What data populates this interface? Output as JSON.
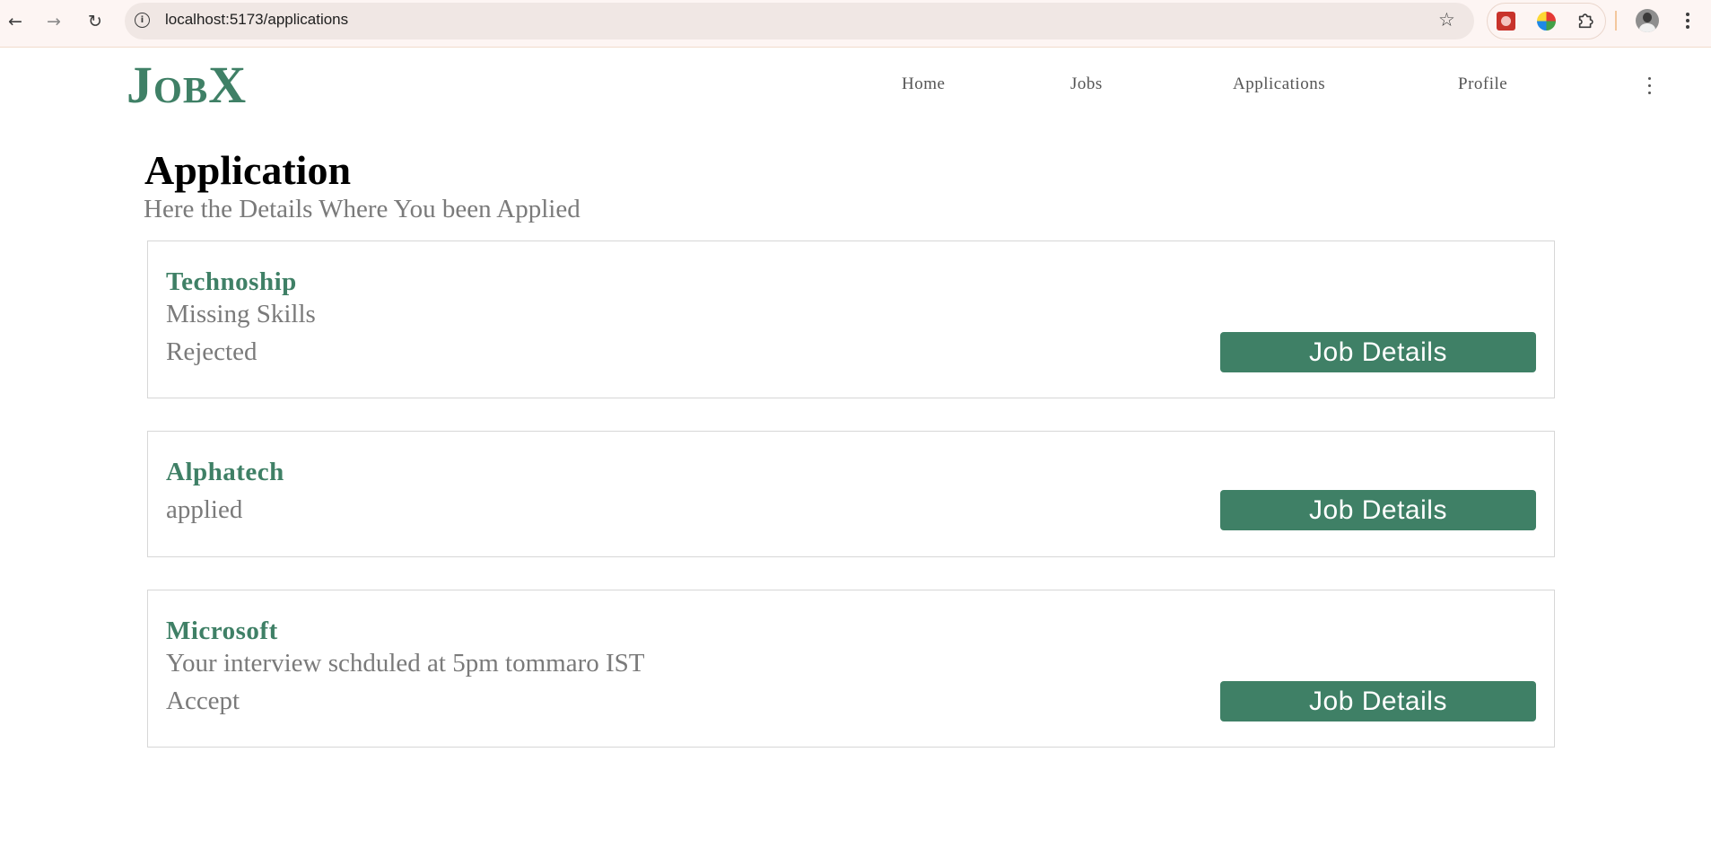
{
  "browser": {
    "url": "localhost:5173/applications",
    "icons": {
      "back": "arrow-left-icon",
      "forward": "arrow-right-icon",
      "reload": "reload-icon",
      "site_info": "info-icon",
      "bookmark": "star-icon",
      "extensions": "puzzle-icon",
      "menu": "kebab-menu-icon"
    }
  },
  "navbar": {
    "logo": "JobX",
    "links": {
      "home": "Home",
      "jobs": "Jobs",
      "applications": "Applications",
      "profile": "Profile"
    }
  },
  "page": {
    "title": "Application",
    "subtitle": "Here the Details Where You been Applied"
  },
  "applications": [
    {
      "company": "Technoship",
      "message": "Missing Skills",
      "status": "Rejected",
      "button_label": "Job Details"
    },
    {
      "company": "Alphatech",
      "status": "applied",
      "button_label": "Job Details"
    },
    {
      "company": "Microsoft",
      "message": "Your interview schduled at 5pm tommaro IST",
      "status": "Accept",
      "button_label": "Job Details"
    }
  ],
  "colors": {
    "brand_green": "#3f8066",
    "muted_text": "#7a7a7a",
    "card_border": "#d7d7d7"
  }
}
